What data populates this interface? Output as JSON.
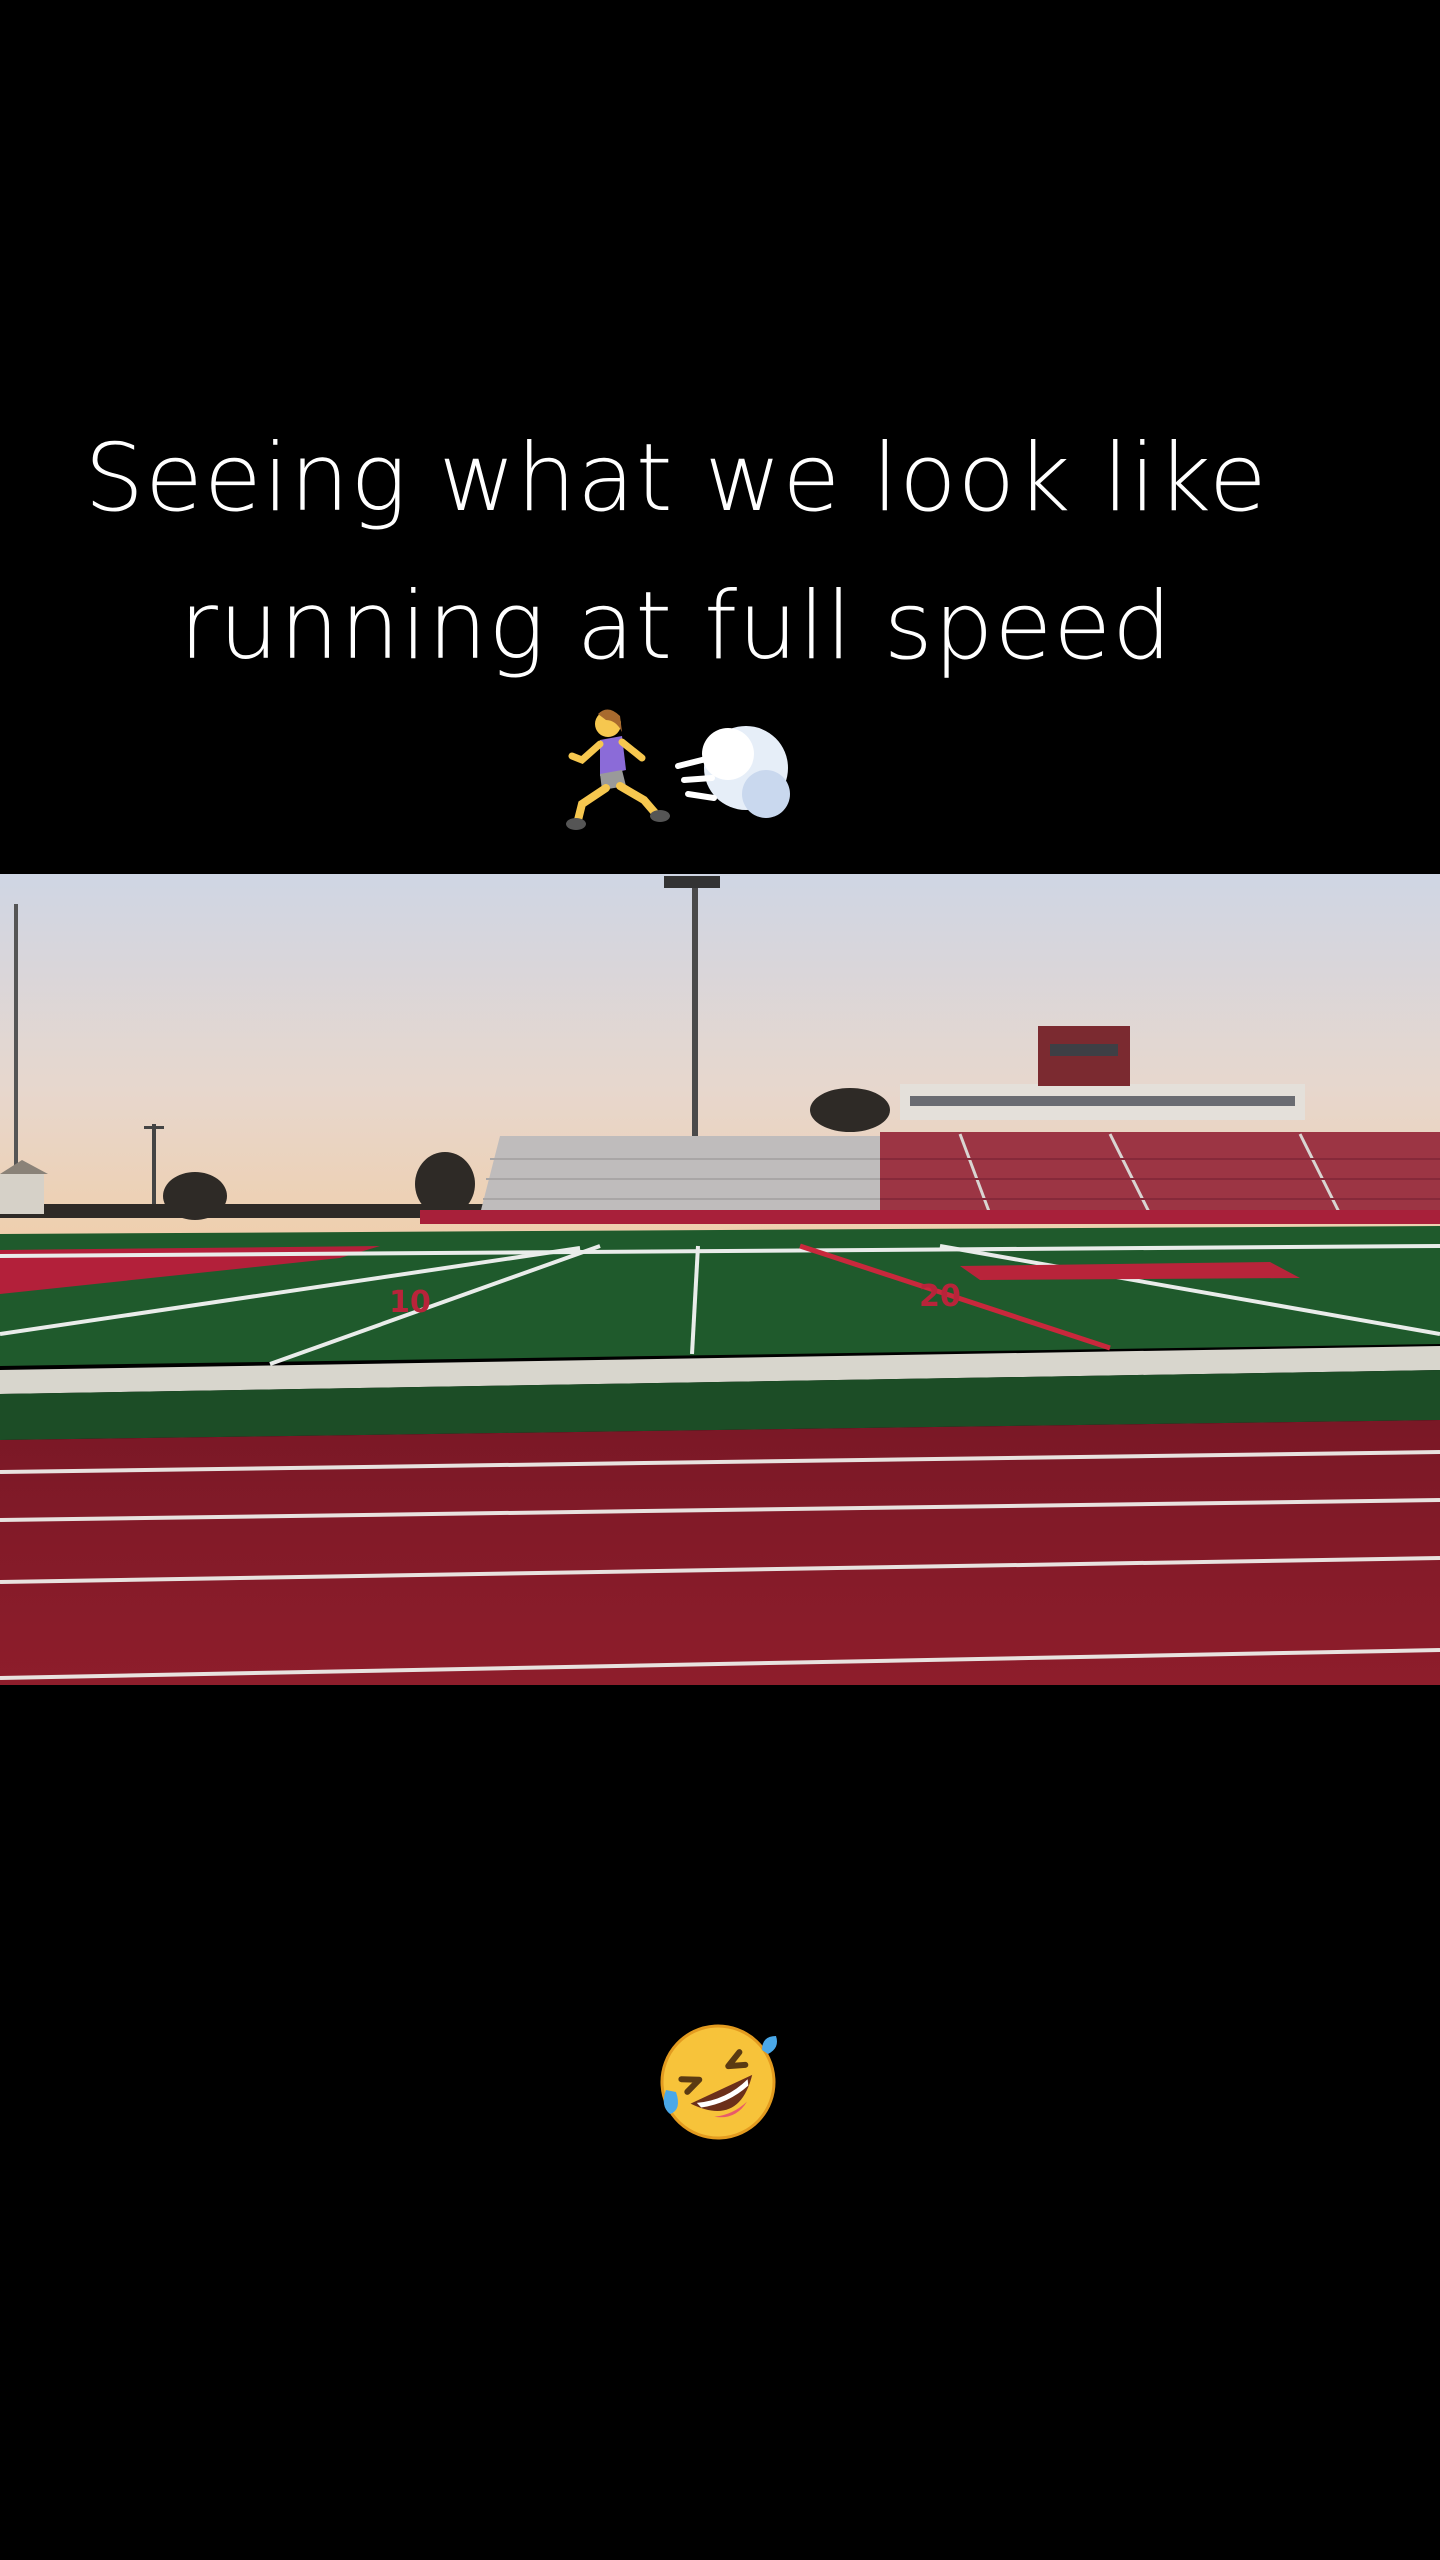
{
  "caption": {
    "line1": "Seeing what we look like",
    "line2": "running at full speed",
    "emojis": [
      "woman-running-icon",
      "dashing-away-icon"
    ]
  },
  "video": {
    "scene": "stadium-track-at-dusk",
    "yard_markers": [
      "10",
      "20"
    ]
  },
  "reaction_emoji": "rolling-on-floor-laughing-icon",
  "colors": {
    "background": "#000000",
    "text": "#ffffff",
    "track": "#8a1c2a",
    "turf": "#1f5a2c",
    "sky_top": "#cfd6e4",
    "sky_bottom": "#efcfae"
  }
}
